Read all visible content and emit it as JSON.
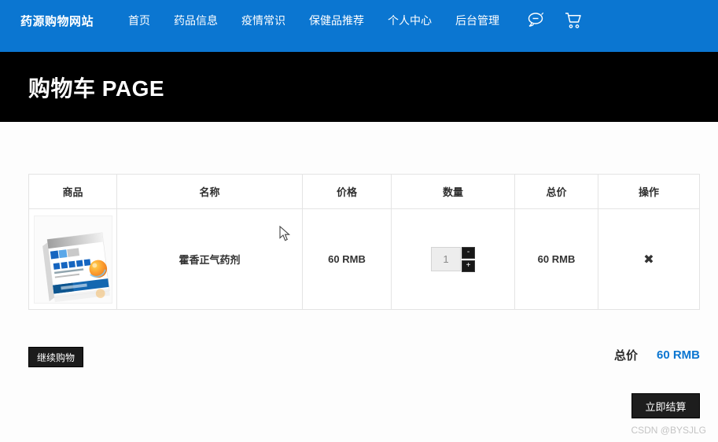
{
  "navbar": {
    "brand": "药源购物网站",
    "items": [
      {
        "label": "首页"
      },
      {
        "label": "药品信息"
      },
      {
        "label": "疫情常识"
      },
      {
        "label": "保健品推荐"
      },
      {
        "label": "个人中心"
      },
      {
        "label": "后台管理"
      }
    ],
    "icons": [
      {
        "name": "chat-icon"
      },
      {
        "name": "cart-icon"
      }
    ]
  },
  "header": {
    "title": "购物车 PAGE"
  },
  "cart_table": {
    "columns": [
      "商品",
      "名称",
      "价格",
      "数量",
      "总价",
      "操作"
    ],
    "rows": [
      {
        "product_image_alt": "阿莫西林颗粒 Amoxicillin Granules 药盒图片",
        "name": "霍香正气药剂",
        "price": "60 RMB",
        "quantity": "1",
        "minus_label": "-",
        "plus_label": "+",
        "total": "60 RMB",
        "remove_label": "✖"
      }
    ]
  },
  "footer": {
    "continue_shopping": "继续购物",
    "total_label": "总价",
    "total_value": "60 RMB",
    "checkout": "立即结算",
    "watermark": "CSDN @BYSJLG"
  },
  "colors": {
    "navbar_bg": "#0b76d1",
    "hero_bg": "#000000",
    "button_dark": "#1c1c1c",
    "total_value_blue": "#0b76d1",
    "table_border": "#e4e4e4"
  }
}
